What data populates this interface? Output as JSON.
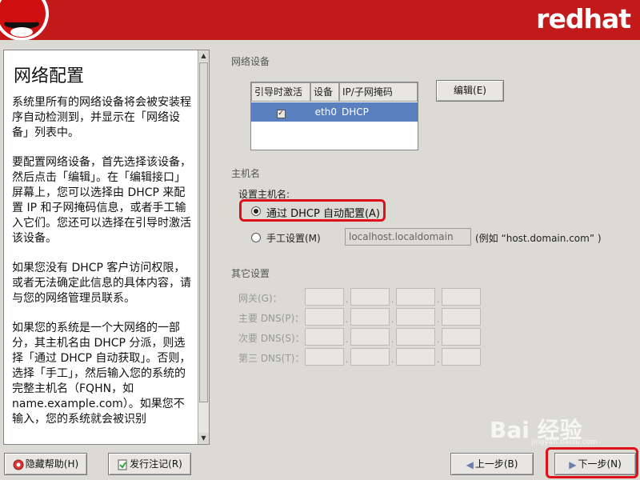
{
  "header": {
    "brand": "redhat"
  },
  "help": {
    "title": "网络配置",
    "paragraphs": [
      "系统里所有的网络设备将会被安装程序自动检测到，并显示在「网络设备」列表中。",
      "要配置网络设备，首先选择该设备，然后点击「编辑」。在「编辑接口」屏幕上，您可以选择由 DHCP 来配置 IP 和子网掩码信息，或者手工输入它们。您还可以选择在引导时激活该设备。",
      "如果您没有 DHCP 客户访问权限，或者无法确定此信息的具体内容，请与您的网络管理员联系。",
      "如果您的系统是一个大网络的一部分，其主机名由 DHCP 分派，则选择「通过 DHCP 自动获取」。否则，选择「手工」，然后输入您的系统的完整主机名（FQHN，如 name.example.com）。如果您不输入，您的系统就会被识别"
    ]
  },
  "network_devices": {
    "label": "网络设备",
    "columns": [
      "引导时激活",
      "设备",
      "IP/子网掩码"
    ],
    "rows": [
      {
        "active": "✓",
        "device": "eth0",
        "ip": "DHCP"
      }
    ],
    "edit_button": "编辑(E)"
  },
  "hostname": {
    "label": "主机名",
    "set_label": "设置主机名:",
    "dhcp_option": "通过 DHCP 自动配置(A)",
    "manual_option": "手工设置(M)",
    "manual_value": "localhost.localdomain",
    "example": "(例如 “host.domain.com” )"
  },
  "other": {
    "label": "其它设置",
    "gateway": "网关(G)：",
    "primary_dns": "主要 DNS(P)：",
    "secondary_dns": "次要 DNS(S)：",
    "tertiary_dns": "第三 DNS(T)："
  },
  "footer": {
    "hide_help": "隐藏帮助(H)",
    "release_notes": "发行注记(R)",
    "back": "上一步(B)",
    "next": "下一步(N)"
  },
  "watermark": {
    "text": "Bai 经验",
    "sub": "jingyan.baidu.com"
  },
  "colors": {
    "header": "#c21a1a",
    "selection": "#5a7fbf",
    "highlight": "#e0101a"
  }
}
